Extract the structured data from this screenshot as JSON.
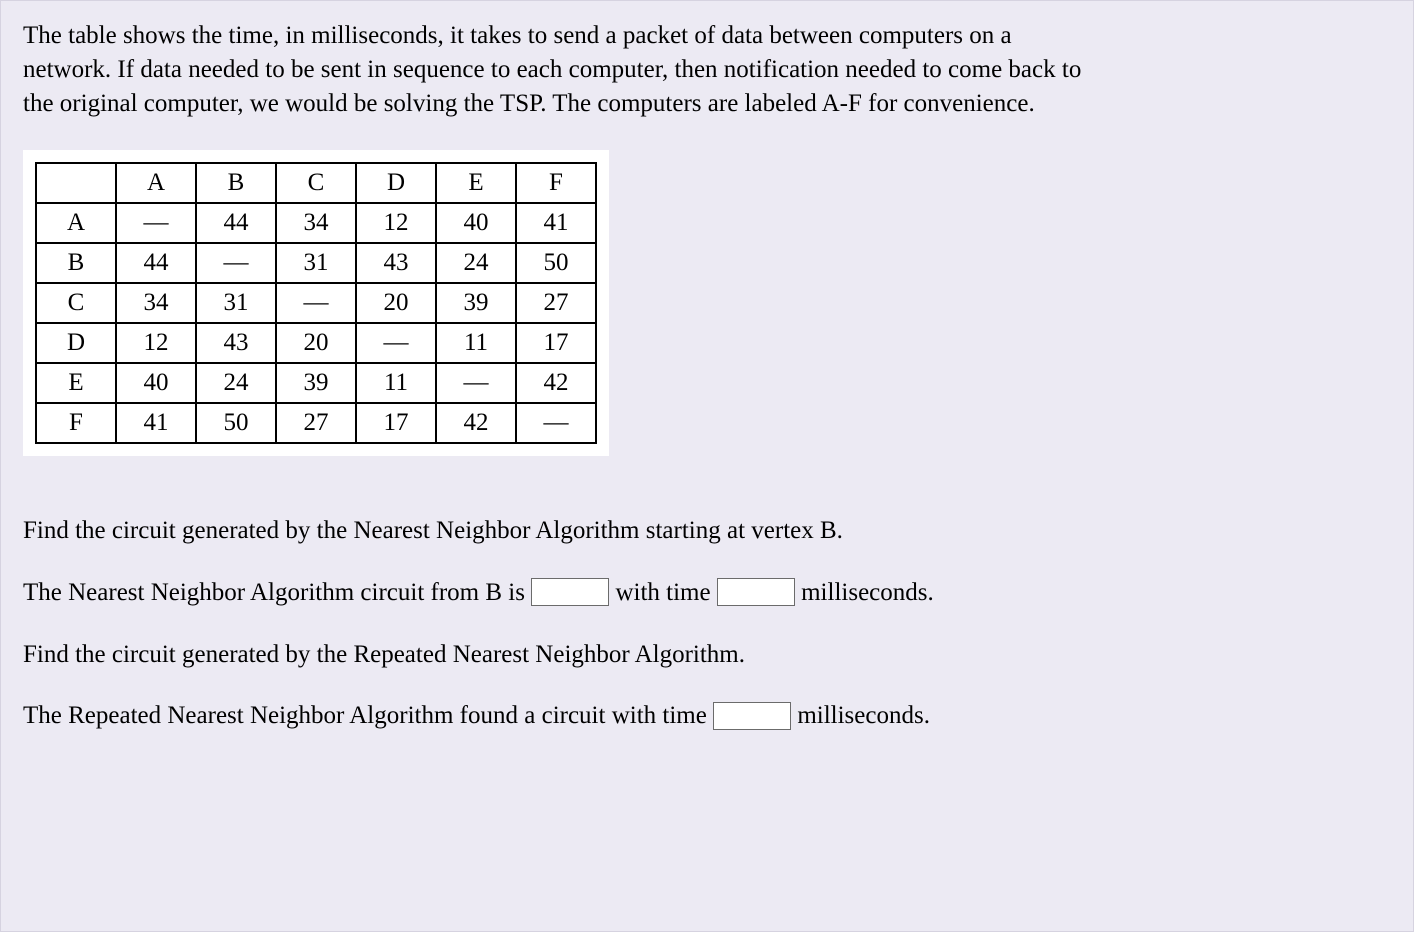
{
  "intro_text": "The table shows the time, in milliseconds, it takes to send a packet of data between computers on a network. If data needed to be sent in sequence to each computer, then notification needed to come back to the original computer, we would be solving the TSP. The computers are labeled A-F for convenience.",
  "table": {
    "col_headers": [
      "",
      "A",
      "B",
      "C",
      "D",
      "E",
      "F"
    ],
    "rows": [
      {
        "label": "A",
        "cells": [
          "—",
          "44",
          "34",
          "12",
          "40",
          "41"
        ]
      },
      {
        "label": "B",
        "cells": [
          "44",
          "—",
          "31",
          "43",
          "24",
          "50"
        ]
      },
      {
        "label": "C",
        "cells": [
          "34",
          "31",
          "—",
          "20",
          "39",
          "27"
        ]
      },
      {
        "label": "D",
        "cells": [
          "12",
          "43",
          "20",
          "—",
          "11",
          "17"
        ]
      },
      {
        "label": "E",
        "cells": [
          "40",
          "24",
          "39",
          "11",
          "—",
          "42"
        ]
      },
      {
        "label": "F",
        "cells": [
          "41",
          "50",
          "27",
          "17",
          "42",
          "—"
        ]
      }
    ]
  },
  "q1_prompt": "Find the circuit generated by the Nearest Neighbor Algorithm starting at vertex B.",
  "q1_line": {
    "pre": "The Nearest Neighbor Algorithm circuit from B is ",
    "mid": " with time ",
    "post": " milliseconds."
  },
  "q2_prompt": "Find the circuit generated by the Repeated Nearest Neighbor Algorithm.",
  "q2_line": {
    "pre": "The Repeated Nearest Neighbor Algorithm found a circuit with time ",
    "post": " milliseconds."
  },
  "inputs": {
    "circuit_from_b": "",
    "time_from_b": "",
    "rnna_time": ""
  }
}
